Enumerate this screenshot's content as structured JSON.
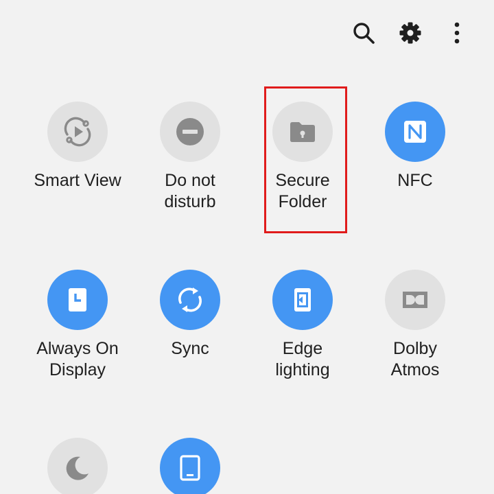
{
  "colors": {
    "background": "#f2f2f2",
    "tile_on": "#4496f3",
    "tile_off": "#e1e1e1",
    "icon_off": "#8a8a8a",
    "highlight": "#e01b1b"
  },
  "toolbar": {
    "icons": [
      "search-icon",
      "gear-icon",
      "more-vert-icon"
    ]
  },
  "tiles": [
    {
      "line1": "Smart View",
      "line2": "",
      "state": "off",
      "icon": "smart-view-icon"
    },
    {
      "line1": "Do not",
      "line2": "disturb",
      "state": "off",
      "icon": "do-not-disturb-icon"
    },
    {
      "line1": "Secure",
      "line2": "Folder",
      "state": "off",
      "icon": "secure-folder-icon"
    },
    {
      "line1": "NFC",
      "line2": "",
      "state": "on",
      "icon": "nfc-icon"
    },
    {
      "line1": "Always On",
      "line2": "Display",
      "state": "on",
      "icon": "always-on-display-icon"
    },
    {
      "line1": "Sync",
      "line2": "",
      "state": "on",
      "icon": "sync-icon"
    },
    {
      "line1": "Edge",
      "line2": "lighting",
      "state": "on",
      "icon": "edge-lighting-icon"
    },
    {
      "line1": "Dolby",
      "line2": "Atmos",
      "state": "off",
      "icon": "dolby-atmos-icon"
    },
    {
      "line1": "",
      "line2": "",
      "state": "off",
      "icon": "night-mode-icon"
    },
    {
      "line1": "",
      "line2": "",
      "state": "on",
      "icon": "tablet-icon"
    }
  ]
}
